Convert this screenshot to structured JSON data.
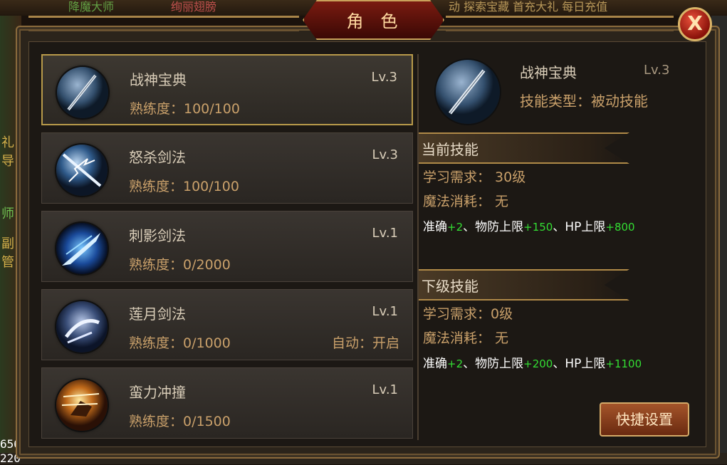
{
  "window": {
    "title": "角色",
    "close_label": "X"
  },
  "background": {
    "top_left_text": "绚丽翅膀",
    "top_left_text2": "降魔大师",
    "top_right_text": "动 探索宝藏 首充大礼 每日充值",
    "side_glyphs": [
      "礼",
      "导",
      "师",
      "副",
      "管"
    ],
    "fps_top": "656",
    "fps_bottom": "220"
  },
  "skills": [
    {
      "name": "战神宝典",
      "level": "Lv.3",
      "proficiency": "熟练度：100/100",
      "auto": "",
      "icon": "sword-orb-icon",
      "selected": true
    },
    {
      "name": "怒杀剑法",
      "level": "Lv.3",
      "proficiency": "熟练度：100/100",
      "auto": "",
      "icon": "lightning-sword-orb-icon",
      "selected": false
    },
    {
      "name": "刺影剑法",
      "level": "Lv.1",
      "proficiency": "熟练度：0/2000",
      "auto": "",
      "icon": "blue-slash-orb-icon",
      "selected": false
    },
    {
      "name": "莲月剑法",
      "level": "Lv.1",
      "proficiency": "熟练度：0/1000",
      "auto": "自动：开启",
      "icon": "moon-blade-orb-icon",
      "selected": false
    },
    {
      "name": "蛮力冲撞",
      "level": "Lv.1",
      "proficiency": "熟练度：0/1500",
      "auto": "",
      "icon": "charge-orb-icon",
      "selected": false
    }
  ],
  "detail": {
    "name": "战神宝典",
    "level": "Lv.3",
    "type": "技能类型：被动技能",
    "current": {
      "title": "当前技能",
      "requirement": "学习需求： 30级",
      "mana": "魔法消耗： 无",
      "stat1_label": "准确",
      "stat1_value": "+2",
      "stat2_label": "、物防上限",
      "stat2_value": "+150",
      "stat3_label": "、HP上限",
      "stat3_value": "+800"
    },
    "next": {
      "title": "下级技能",
      "requirement": "学习需求：0级",
      "mana": "魔法消耗： 无",
      "stat1_label": "准确",
      "stat1_value": "+2",
      "stat2_label": "、物防上限",
      "stat2_value": "+200",
      "stat3_label": "、HP上限",
      "stat3_value": "+1100"
    }
  },
  "shortcut_button": "快捷设置",
  "colors": {
    "accent_gold": "#c9a06a",
    "stat_green": "#33dd33"
  }
}
